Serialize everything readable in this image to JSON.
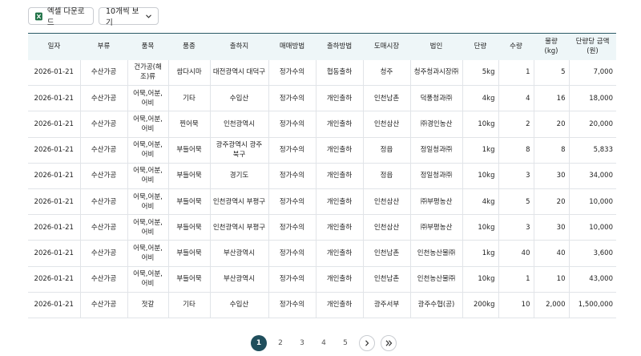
{
  "toolbar": {
    "excel_label": "엑셀 다운로드",
    "per_page_label": "10개씩 보기"
  },
  "table": {
    "headers": [
      "일자",
      "부류",
      "품목",
      "품종",
      "출하지",
      "매매방법",
      "출하방법",
      "도매시장",
      "법인",
      "단량",
      "수량",
      "물량\n(kg)",
      "단량당 금액\n(원)"
    ],
    "rows": [
      [
        "2026-01-21",
        "수산가공",
        "건가공(해조)류",
        "쌈다시마",
        "대전광역시 대덕구",
        "정가수의",
        "협동출하",
        "청주",
        "청주청과시장㈜",
        "5kg",
        "1",
        "5",
        "7,000"
      ],
      [
        "2026-01-21",
        "수산가공",
        "어묵,어분,어비",
        "기타",
        "수입산",
        "정가수의",
        "개인출하",
        "인천남촌",
        "덕풍청과㈜",
        "4kg",
        "4",
        "16",
        "18,000"
      ],
      [
        "2026-01-21",
        "수산가공",
        "어묵,어분,어비",
        "찐어묵",
        "인천광역시",
        "정가수의",
        "개인출하",
        "인천삼산",
        "㈜경인농산",
        "10kg",
        "2",
        "20",
        "20,000"
      ],
      [
        "2026-01-21",
        "수산가공",
        "어묵,어분,어비",
        "부들어묵",
        "광주광역시 광주 북구",
        "정가수의",
        "개인출하",
        "정읍",
        "정일청과㈜",
        "1kg",
        "8",
        "8",
        "5,833"
      ],
      [
        "2026-01-21",
        "수산가공",
        "어묵,어분,어비",
        "부들어묵",
        "경기도",
        "정가수의",
        "개인출하",
        "정읍",
        "정일청과㈜",
        "10kg",
        "3",
        "30",
        "34,000"
      ],
      [
        "2026-01-21",
        "수산가공",
        "어묵,어분,어비",
        "부들어묵",
        "인천광역시 부평구",
        "정가수의",
        "개인출하",
        "인천삼산",
        "㈜부평농산",
        "4kg",
        "5",
        "20",
        "10,000"
      ],
      [
        "2026-01-21",
        "수산가공",
        "어묵,어분,어비",
        "부들어묵",
        "인천광역시 부평구",
        "정가수의",
        "개인출하",
        "인천삼산",
        "㈜부평농산",
        "10kg",
        "3",
        "30",
        "10,000"
      ],
      [
        "2026-01-21",
        "수산가공",
        "어묵,어분,어비",
        "부들어묵",
        "부산광역시",
        "정가수의",
        "개인출하",
        "인천남촌",
        "인천농산물㈜",
        "1kg",
        "40",
        "40",
        "3,600"
      ],
      [
        "2026-01-21",
        "수산가공",
        "어묵,어분,어비",
        "부들어묵",
        "부산광역시",
        "정가수의",
        "개인출하",
        "인천남촌",
        "인천농산물㈜",
        "10kg",
        "1",
        "10",
        "43,000"
      ],
      [
        "2026-01-21",
        "수산가공",
        "젓갈",
        "기타",
        "수입산",
        "정가수의",
        "개인출하",
        "광주서부",
        "광주수협(공)",
        "200kg",
        "10",
        "2,000",
        "1,500,000"
      ]
    ]
  },
  "pagination": {
    "pages": [
      "1",
      "2",
      "3",
      "4",
      "5"
    ],
    "current": "1",
    "next_icon": "chevron-right",
    "last_icon": "double-chevron-right"
  },
  "colors": {
    "header_bg": "#eef6f8",
    "header_border": "#2b5b67",
    "active_page": "#1f4e5c",
    "excel_green": "#1e7145"
  }
}
